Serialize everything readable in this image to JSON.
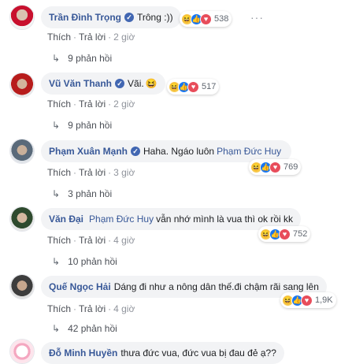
{
  "comments": [
    {
      "author": "Trần Đình Trọng",
      "verified": true,
      "tag": "",
      "text": "Trông :))",
      "emoji": "",
      "reaction_count": "538",
      "actions": [
        "Thích",
        "Trả lời"
      ],
      "time": "2 giờ",
      "replies": "9 phản hồi",
      "more": "···"
    },
    {
      "author": "Vũ Văn Thanh",
      "verified": true,
      "tag": "",
      "text": "Vãi.",
      "emoji": "😆",
      "reaction_count": "517",
      "actions": [
        "Thích",
        "Trả lời"
      ],
      "time": "2 giờ",
      "replies": "9 phản hồi"
    },
    {
      "author": "Phạm Xuân Mạnh",
      "verified": true,
      "tag": "",
      "text": "Haha. Ngáo luôn",
      "tag_after": "Phạm Đức Huy",
      "emoji": "",
      "reaction_count": "769",
      "actions": [
        "Thích",
        "Trả lời"
      ],
      "time": "3 giờ",
      "replies": "3 phản hồi"
    },
    {
      "author": "Văn Đại",
      "verified": false,
      "tag": "Phạm Đức Huy",
      "text": "vẫn nhớ mình là vua thì ok rồi kk",
      "emoji": "",
      "reaction_count": "752",
      "actions": [
        "Thích",
        "Trả lời"
      ],
      "time": "4 giờ",
      "replies": "10 phản hồi"
    },
    {
      "author": "Quế Ngọc Hải",
      "verified": false,
      "tag": "",
      "text": "Dáng đi như a nông dân thế.đi chậm rãi sang lên",
      "emoji": "",
      "reaction_count": "1,9K",
      "actions": [
        "Thích",
        "Trả lời"
      ],
      "time": "4 giờ",
      "replies": "42 phản hồi"
    },
    {
      "author": "Đỗ Minh Huyền",
      "verified": false,
      "tag": "",
      "text": "thưa đức vua, đức vua bị đau đẻ ạ??",
      "emoji": ""
    }
  ],
  "reply_arrow": "↳",
  "separator": "·",
  "reaction_icons": [
    "haha-icon",
    "like-icon",
    "love-icon"
  ],
  "colors": {
    "link": "#385898",
    "bubble_bg": "#f2f3f5",
    "meta": "#90949c"
  }
}
